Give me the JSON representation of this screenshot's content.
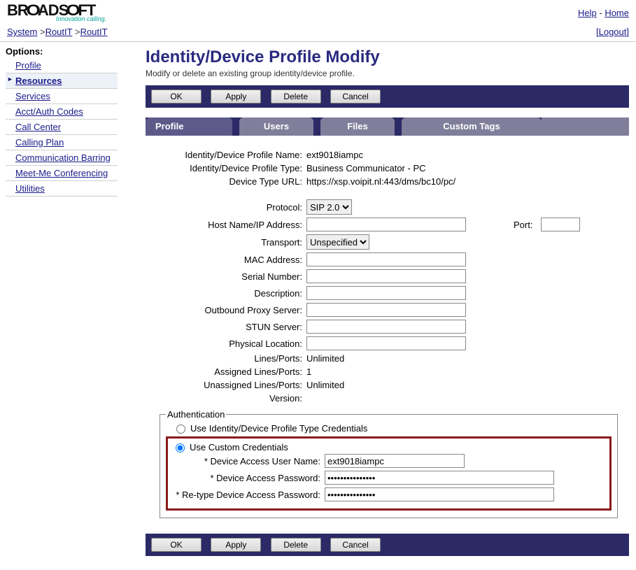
{
  "header": {
    "brand": "BROADSOFT",
    "tagline": "Innovation calling.",
    "help": "Help",
    "home": "Home"
  },
  "breadcrumb": {
    "system": "System",
    "sp1": "RoutIT",
    "sp2": "RoutIT",
    "logout": "[Logout]"
  },
  "sidebar": {
    "title": "Options:",
    "items": [
      {
        "label": "Profile"
      },
      {
        "label": "Resources"
      },
      {
        "label": "Services"
      },
      {
        "label": "Acct/Auth Codes"
      },
      {
        "label": "Call Center"
      },
      {
        "label": "Calling Plan"
      },
      {
        "label": "Communication Barring"
      },
      {
        "label": "Meet-Me Conferencing"
      },
      {
        "label": "Utilities"
      }
    ]
  },
  "page": {
    "title": "Identity/Device Profile Modify",
    "subtitle": "Modify or delete an existing group identity/device profile."
  },
  "buttons": {
    "ok": "OK",
    "apply": "Apply",
    "delete": "Delete",
    "cancel": "Cancel"
  },
  "tabs": {
    "profile": "Profile",
    "users": "Users",
    "files": "Files",
    "custom": "Custom Tags"
  },
  "form": {
    "profileNameLabel": "Identity/Device Profile Name:",
    "profileName": "ext9018iampc",
    "profileTypeLabel": "Identity/Device Profile Type:",
    "profileType": "Business Communicator - PC",
    "deviceUrlLabel": "Device Type URL:",
    "deviceUrl": "https://xsp.voipit.nl:443/dms/bc10/pc/",
    "protocolLabel": "Protocol:",
    "protocol": "SIP 2.0",
    "hostLabel": "Host Name/IP Address:",
    "host": "",
    "portLabel": "Port:",
    "port": "",
    "transportLabel": "Transport:",
    "transport": "Unspecified",
    "macLabel": "MAC Address:",
    "mac": "",
    "serialLabel": "Serial Number:",
    "serial": "",
    "descLabel": "Description:",
    "desc": "",
    "proxyLabel": "Outbound Proxy Server:",
    "proxy": "",
    "stunLabel": "STUN Server:",
    "stun": "",
    "physLabel": "Physical Location:",
    "phys": "",
    "linesPortsLabel": "Lines/Ports:",
    "linesPorts": "Unlimited",
    "assignedLabel": "Assigned Lines/Ports:",
    "assigned": "1",
    "unassignedLabel": "Unassigned Lines/Ports:",
    "unassigned": "Unlimited",
    "versionLabel": "Version:",
    "version": ""
  },
  "auth": {
    "legend": "Authentication",
    "useProfile": "Use Identity/Device Profile Type Credentials",
    "useCustom": "Use Custom Credentials",
    "userLabel": "* Device Access User Name:",
    "userName": "ext9018iampc",
    "pwLabel": "* Device Access Password:",
    "pwValue": "●●●●●●●●●●●●●●●",
    "pw2Label": "* Re-type Device Access Password:",
    "pw2Value": "●●●●●●●●●●●●●●●"
  }
}
